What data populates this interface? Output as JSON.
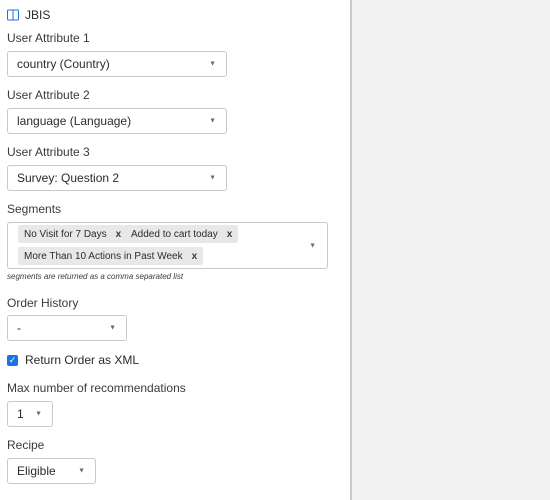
{
  "header": {
    "title": "JBIS",
    "icon": "book-icon"
  },
  "fields": {
    "attr1": {
      "label": "User Attribute 1",
      "value": "country (Country)"
    },
    "attr2": {
      "label": "User Attribute 2",
      "value": "language (Language)"
    },
    "attr3": {
      "label": "User Attribute 3",
      "value": "Survey: Question 2"
    },
    "segments": {
      "label": "Segments",
      "pills": [
        "No Visit for 7 Days",
        "Added to cart today",
        "More Than 10 Actions in Past Week"
      ],
      "hint": "segments are returned as a comma separated list"
    },
    "order_history": {
      "label": "Order History",
      "value": "-"
    },
    "return_xml": {
      "label": "Return Order as XML",
      "checked": true
    },
    "max_recs": {
      "label": "Max number of recommendations",
      "value": "1"
    },
    "recipe": {
      "label": "Recipe",
      "value": "Eligible"
    }
  },
  "glyphs": {
    "caret": "▼",
    "remove": "x",
    "check": "✓"
  },
  "colors": {
    "accent": "#1a73e8",
    "panel_bg": "#f2f2f3",
    "pill_bg": "#e8e8e8"
  }
}
